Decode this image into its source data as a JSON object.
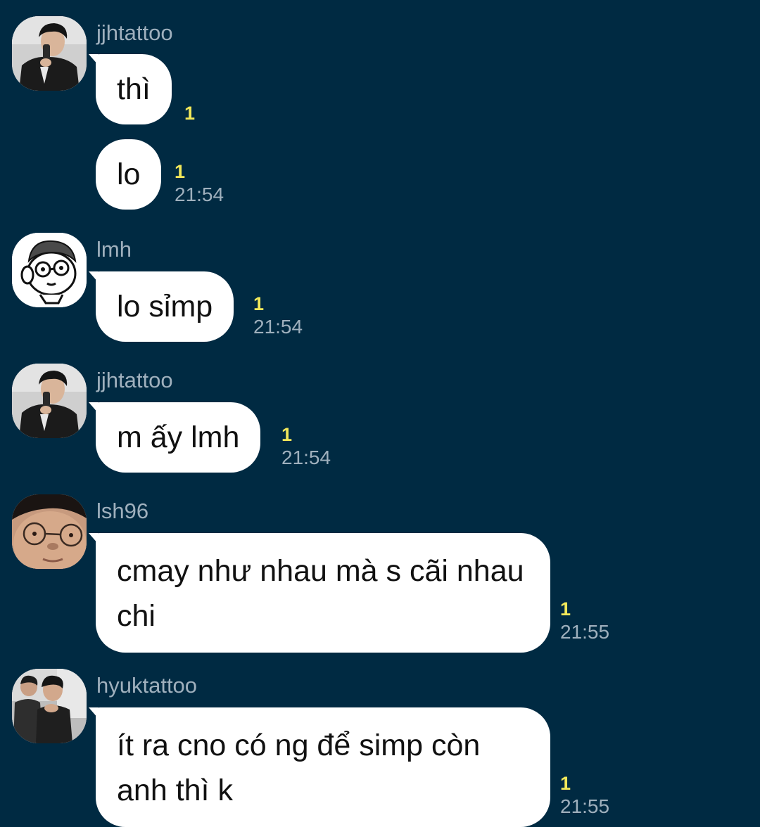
{
  "colors": {
    "background": "#002a42",
    "bubble": "#ffffff",
    "sender_name": "#9fb0bd",
    "unread_count": "#f2e85a",
    "timestamp": "#9fb0bd"
  },
  "messages": [
    {
      "sender": "jjhtattoo",
      "avatar": "avatar-photo-jjhtattoo",
      "bubbles": [
        {
          "text": "thì",
          "unread": "1",
          "time": ""
        },
        {
          "text": "lo",
          "unread": "1",
          "time": "21:54"
        }
      ]
    },
    {
      "sender": "lmh",
      "avatar": "avatar-cartoon-lmh",
      "bubbles": [
        {
          "text": "lo sỉmp",
          "unread": "1",
          "time": "21:54"
        }
      ]
    },
    {
      "sender": "jjhtattoo",
      "avatar": "avatar-photo-jjhtattoo",
      "bubbles": [
        {
          "text": "m ấy lmh",
          "unread": "1",
          "time": "21:54"
        }
      ]
    },
    {
      "sender": "lsh96",
      "avatar": "avatar-photo-lsh96",
      "bubbles": [
        {
          "text": "cmay như nhau mà s cãi nhau chi",
          "unread": "1",
          "time": "21:55"
        }
      ]
    },
    {
      "sender": "hyuktattoo",
      "avatar": "avatar-photo-hyuktattoo",
      "bubbles": [
        {
          "text": "ít ra cno có ng để simp còn anh thì k",
          "unread": "1",
          "time": "21:55"
        }
      ]
    }
  ]
}
